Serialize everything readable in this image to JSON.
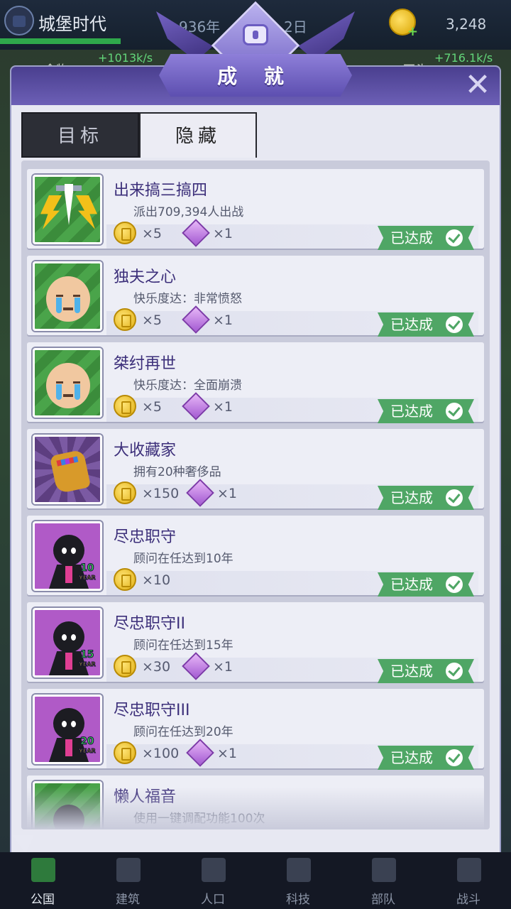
{
  "hud": {
    "game_name": "城堡时代",
    "year": "936年",
    "day": "2日",
    "gold": "3,248",
    "rate_left": "+1013k/s",
    "rate_right": "+716.1k/s",
    "res_left": "食物",
    "res_right": "石头"
  },
  "dialog": {
    "title": "成 就",
    "close": "✕"
  },
  "tabs": [
    {
      "label": "目标",
      "active": false
    },
    {
      "label": "隐藏",
      "active": true
    }
  ],
  "achievements": [
    {
      "title": "出来搞三搞四",
      "desc": "派出709,394人出战",
      "coins": "×5",
      "gems": "×1",
      "status": "已达成",
      "icon": "sword-lightning-icon"
    },
    {
      "title": "独夫之心",
      "desc": "快乐度达：非常愤怒",
      "coins": "×5",
      "gems": "×1",
      "status": "已达成",
      "icon": "crying-face-icon"
    },
    {
      "title": "桀纣再世",
      "desc": "快乐度达：全面崩溃",
      "coins": "×5",
      "gems": "×1",
      "status": "已达成",
      "icon": "crying-face-icon"
    },
    {
      "title": "大收藏家",
      "desc": "拥有20种奢侈品",
      "coins": "×150",
      "gems": "×1",
      "status": "已达成",
      "icon": "gauntlet-icon"
    },
    {
      "title": "尽忠职守",
      "desc": "顾问在任达到10年",
      "coins": "×10",
      "gems": "",
      "status": "已达成",
      "icon": "advisor-10-year-icon",
      "years": "10"
    },
    {
      "title": "尽忠职守II",
      "desc": "顾问在任达到15年",
      "coins": "×30",
      "gems": "×1",
      "status": "已达成",
      "icon": "advisor-15-year-icon",
      "years": "15"
    },
    {
      "title": "尽忠职守III",
      "desc": "顾问在任达到20年",
      "coins": "×100",
      "gems": "×1",
      "status": "已达成",
      "icon": "advisor-20-year-icon",
      "years": "20"
    },
    {
      "title": "懒人福音",
      "desc": "使用一键调配功能100次",
      "coins": "",
      "gems": "",
      "status": "",
      "icon": "lazy-people-icon"
    }
  ],
  "nav": [
    {
      "label": "公国",
      "active": true
    },
    {
      "label": "建筑"
    },
    {
      "label": "人口"
    },
    {
      "label": "科技"
    },
    {
      "label": "部队"
    },
    {
      "label": "战斗"
    }
  ],
  "year_label": "YEAR",
  "colors": {
    "accent": "#6c5fb6",
    "done": "#4fa665"
  }
}
